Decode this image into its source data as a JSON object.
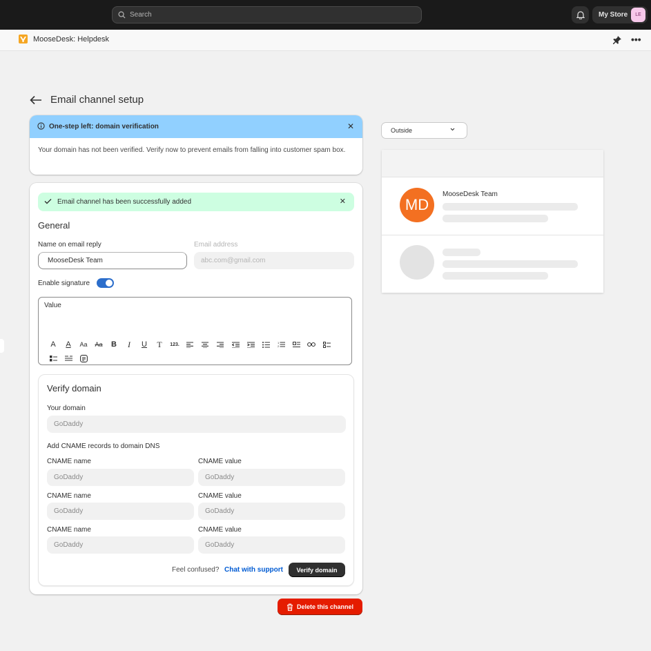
{
  "topbar": {
    "search_placeholder": "Search",
    "store_name": "My Store",
    "store_initials": "LE"
  },
  "app": {
    "title": "MooseDesk: Helpdesk"
  },
  "page": {
    "title": "Email channel setup"
  },
  "banner": {
    "title": "One-step left: domain verification",
    "body": "Your domain has not been verified. Verify now to prevent emails from falling into customer spam box."
  },
  "success": {
    "message": "Email channel has been successfully added"
  },
  "general": {
    "heading": "General",
    "name_label": "Name on email reply",
    "name_value": "MooseDesk Team",
    "email_label": "Email address",
    "email_placeholder": "abc.com@gmail.com",
    "signature_label": "Enable signature",
    "signature_enabled": true,
    "editor_value": "Value"
  },
  "verify": {
    "heading": "Verify domain",
    "domain_label": "Your domain",
    "domain_value": "GoDaddy",
    "cname_heading": "Add CNAME records to domain DNS",
    "records": [
      {
        "name_label": "CNAME name",
        "name_value": "GoDaddy",
        "value_label": "CNAME value",
        "value_value": "GoDaddy"
      },
      {
        "name_label": "CNAME name",
        "name_value": "GoDaddy",
        "value_label": "CNAME value",
        "value_value": "GoDaddy"
      },
      {
        "name_label": "CNAME name",
        "name_value": "GoDaddy",
        "value_label": "CNAME value",
        "value_value": "GoDaddy"
      }
    ],
    "confused_text": "Feel confused?",
    "support_link": "Chat with support",
    "verify_button": "Verify domain"
  },
  "delete_button": "Delete this channel",
  "preview": {
    "select_value": "Outside",
    "sender_initials": "MD",
    "sender_name": "MooseDesk Team"
  },
  "colors": {
    "banner": "#91d0ff",
    "success": "#cdfee1",
    "accent": "#2c6ecb",
    "danger": "#e51c00",
    "avatar": "#f37021"
  }
}
